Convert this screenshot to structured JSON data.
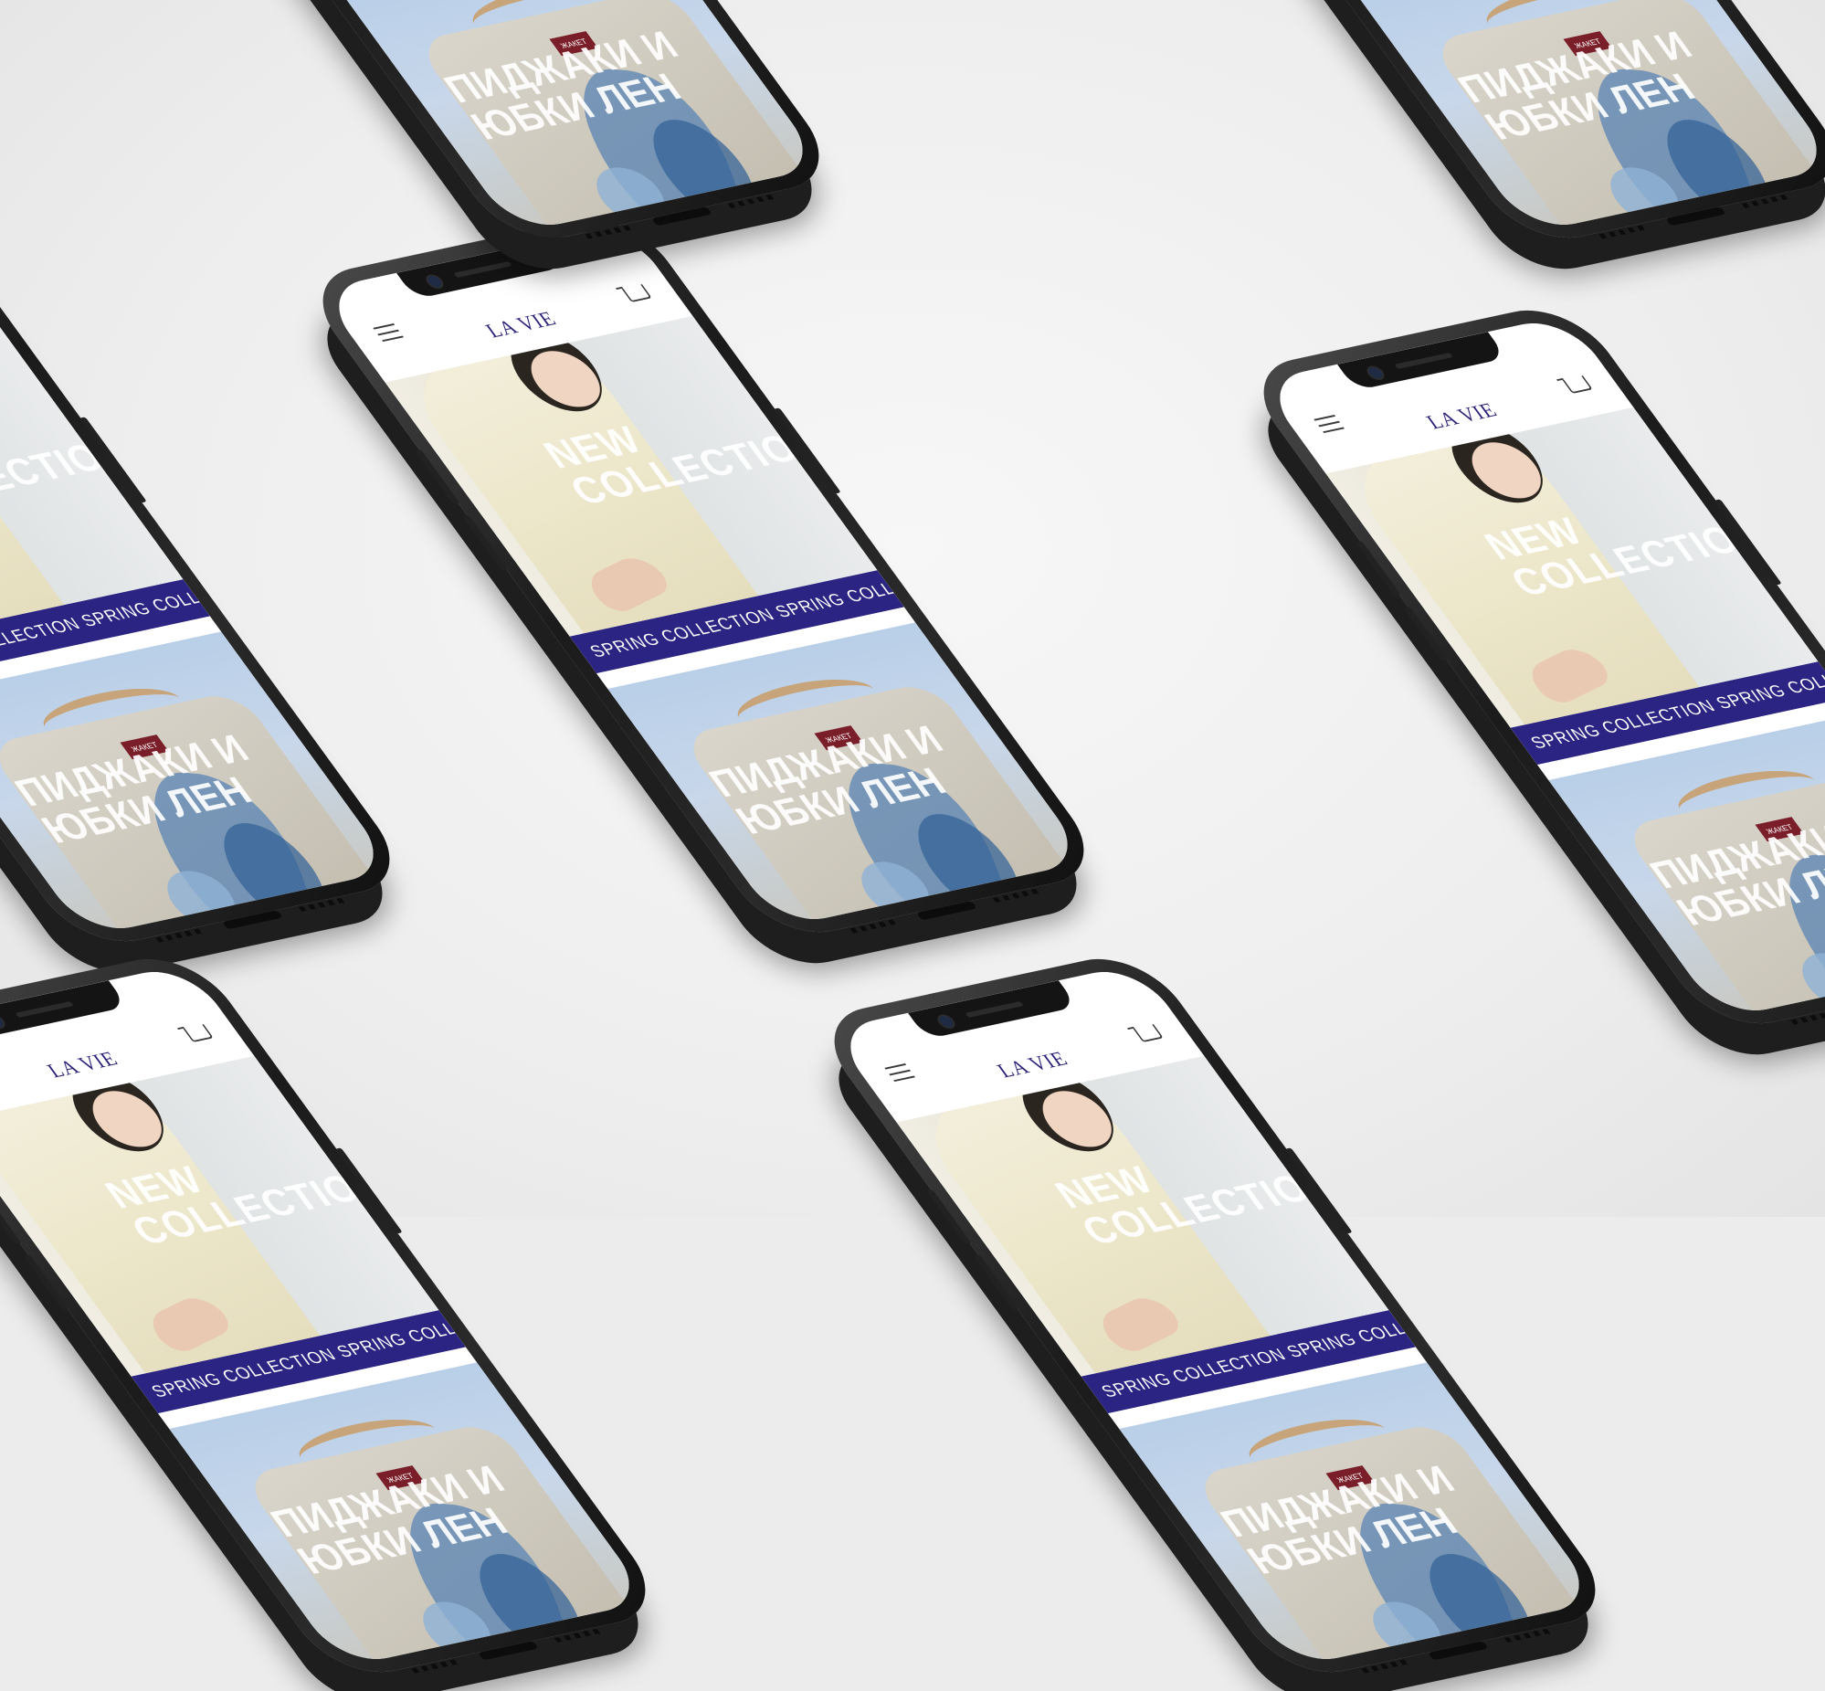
{
  "site": {
    "logo": "LA VIE",
    "hero_title": "NEW COLLECTION",
    "ticker_text": "SPRING COLLECTION SPRING COLLECTION SPRING COLLECTION SPRING",
    "promo_title": "ПИДЖАКИ И ЮБКИ ЛЕН",
    "promo_tag": "ЖАКЕТ"
  },
  "colors": {
    "brand": "#2b2483",
    "background": "#ececec",
    "phone_frame": "#1b1b1b"
  },
  "icons": [
    "menu-icon",
    "cart-icon"
  ]
}
